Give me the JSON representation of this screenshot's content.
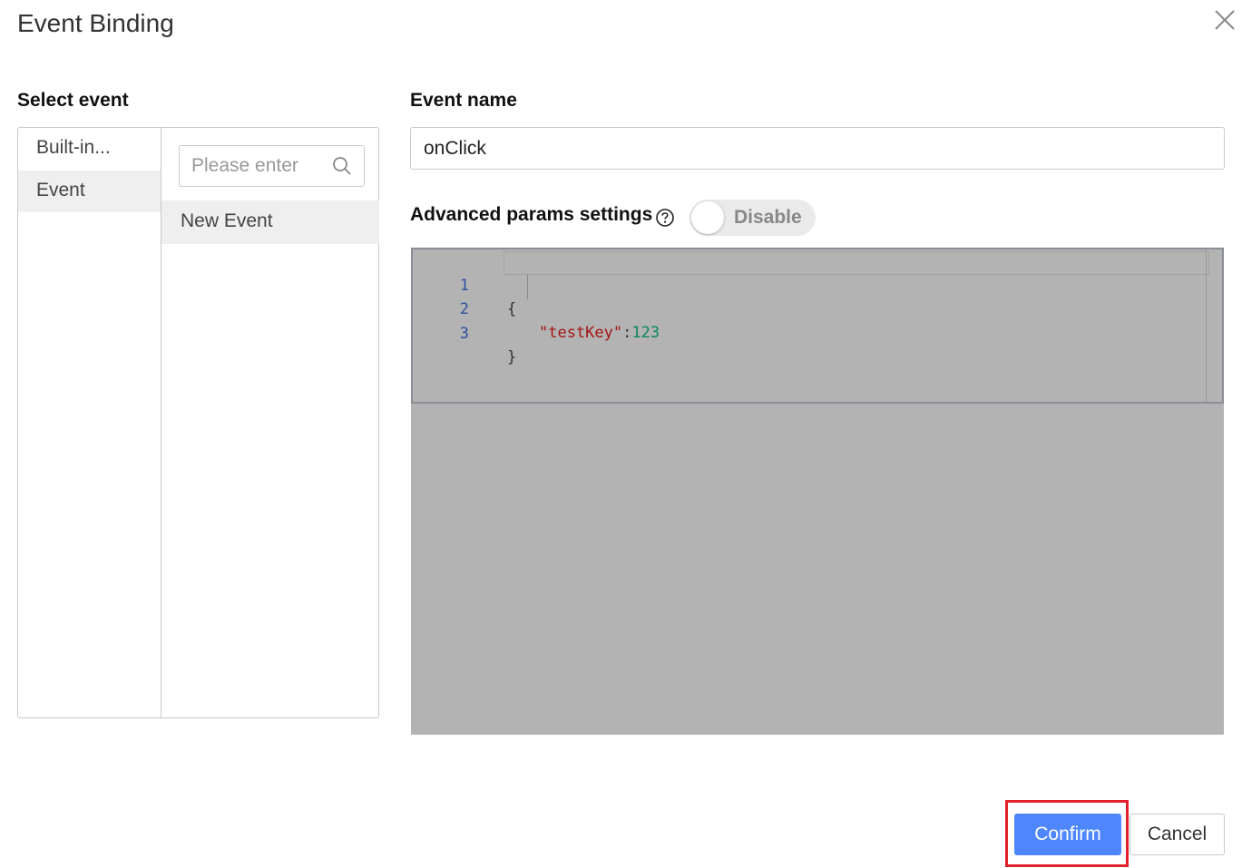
{
  "dialog": {
    "title": "Event Binding"
  },
  "select_event": {
    "label": "Select event",
    "categories": [
      {
        "label": "Built-in...",
        "active": false
      },
      {
        "label": "Event",
        "active": true
      }
    ],
    "search": {
      "placeholder": "Please enter",
      "value": ""
    },
    "events": [
      {
        "label": "New Event",
        "selected": true
      }
    ]
  },
  "event_name": {
    "label": "Event name",
    "value": "onClick"
  },
  "advanced": {
    "label": "Advanced params settings",
    "toggle_label": "Disable",
    "toggle_enabled": false
  },
  "editor": {
    "lines": [
      {
        "number": "1",
        "text": "{"
      },
      {
        "number": "2",
        "key": "\"testKey\"",
        "colon": ":",
        "value": "123"
      },
      {
        "number": "3",
        "text": "}"
      }
    ]
  },
  "footer": {
    "confirm_label": "Confirm",
    "cancel_label": "Cancel"
  },
  "colors": {
    "primary": "#4e86ff",
    "highlight_border": "#e0202a",
    "editor_overlay": "#b3b3b3"
  }
}
